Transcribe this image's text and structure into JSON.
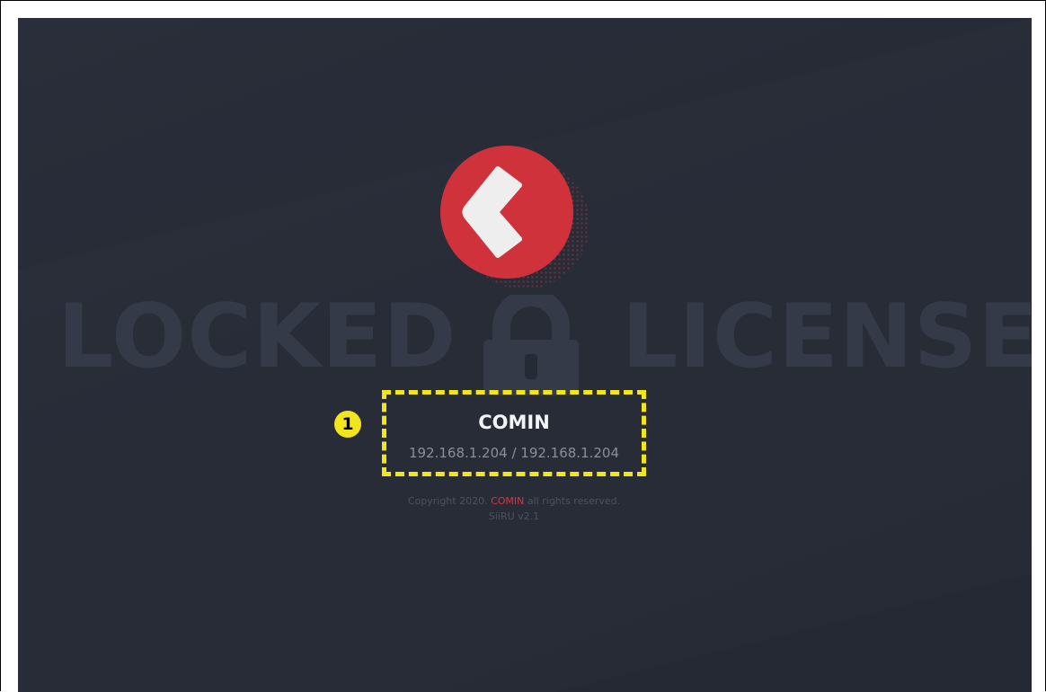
{
  "watermark": {
    "left_word": "LOCKED",
    "right_word": "LICENSE"
  },
  "icons": {
    "logo": "comin-logo",
    "lock": "lock-icon"
  },
  "annotation": {
    "badge_label": "1"
  },
  "info": {
    "app_name": "COMIN",
    "ip_address": "192.168.1.204 / 192.168.1.204"
  },
  "footer": {
    "copyright_prefix": "Copyright 2020. ",
    "copyright_brand": "COMIN",
    "copyright_suffix": " all rights reserved.",
    "version": "SiiRU v2.1"
  },
  "colors": {
    "background": "#262a35",
    "logo_red": "#d0323c",
    "highlight_yellow": "#f2e51c",
    "brand_red": "#d8353f"
  }
}
